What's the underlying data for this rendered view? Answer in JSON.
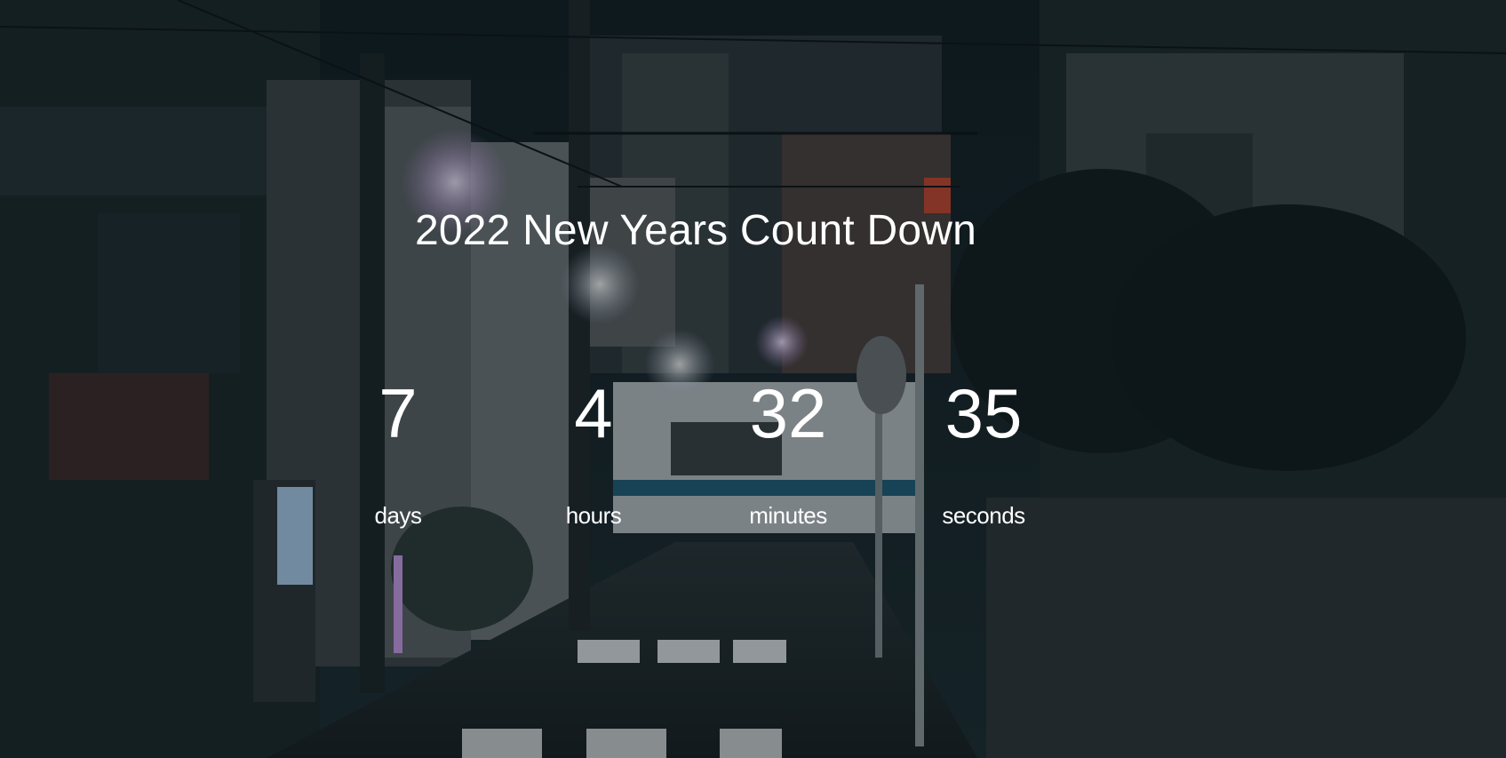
{
  "title": "2022 New Years Count Down",
  "countdown": {
    "days": {
      "value": "7",
      "label": "days"
    },
    "hours": {
      "value": "4",
      "label": "hours"
    },
    "minutes": {
      "value": "32",
      "label": "minutes"
    },
    "seconds": {
      "value": "35",
      "label": "seconds"
    }
  },
  "background": {
    "subject": "night-city-street-photo",
    "palette": {
      "sky": "#142228",
      "building_dark": "#1a2a30",
      "building_mid": "#2e3b40",
      "road": "#1c262a",
      "lamp_glow": "#e9d4ff",
      "train": "#c8cdd2",
      "train_stripe": "#1f5d7a"
    }
  }
}
